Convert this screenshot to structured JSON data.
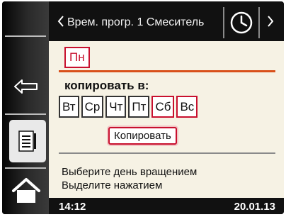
{
  "header": {
    "title": "Врем. прогр. 1 Смеситель",
    "back_icon": "chevron-left-icon",
    "clock_icon": "clock-icon",
    "next_icon": "chevron-right-icon"
  },
  "sidebar": {
    "items": [
      {
        "icon": "back-arrow-icon"
      },
      {
        "icon": "document-icon"
      },
      {
        "icon": "home-icon"
      }
    ]
  },
  "content": {
    "source_day": "Пн",
    "copy_to_label": "копировать в:",
    "target_days": [
      {
        "label": "Вт",
        "selected": false
      },
      {
        "label": "Ср",
        "selected": false
      },
      {
        "label": "Чт",
        "selected": false
      },
      {
        "label": "Пт",
        "selected": false
      },
      {
        "label": "Сб",
        "selected": true
      },
      {
        "label": "Вс",
        "selected": true
      }
    ],
    "copy_button": "Копировать",
    "hint_line1": "Выберите день вращением",
    "hint_line2": "Выделите нажатием"
  },
  "footer": {
    "time": "14:12",
    "date": "20.01.13"
  },
  "colors": {
    "accent_red": "#c8102e",
    "highlight_orange": "#d9501a",
    "panel_background": "#f6f2e4"
  }
}
